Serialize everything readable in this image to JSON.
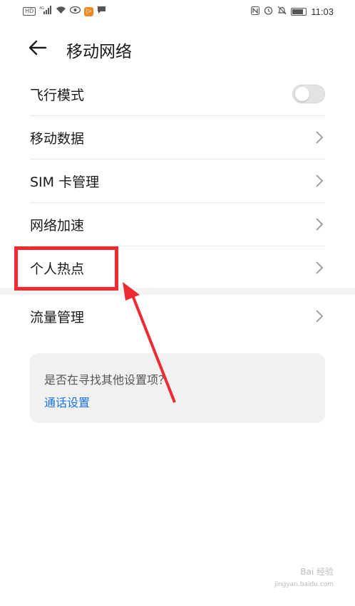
{
  "status_bar": {
    "left_icons": [
      "hd-icon",
      "signal-4g-icon",
      "wifi-icon",
      "eye-icon",
      "app-badge-icon",
      "message-icon"
    ],
    "right_icons": [
      "nfc-icon",
      "alarm-icon",
      "mute-icon",
      "battery-icon"
    ],
    "time": "11:03"
  },
  "header": {
    "title": "移动网络"
  },
  "settings": {
    "items": [
      {
        "label": "飞行模式",
        "control": "toggle",
        "toggle_on": false
      },
      {
        "label": "移动数据",
        "control": "chevron"
      },
      {
        "label": "SIM 卡管理",
        "control": "chevron"
      },
      {
        "label": "网络加速",
        "control": "chevron"
      },
      {
        "label": "个人热点",
        "control": "chevron"
      }
    ],
    "extra_item": {
      "label": "流量管理",
      "control": "chevron"
    }
  },
  "suggestion": {
    "question": "是否在寻找其他设置项？",
    "link": "通话设置"
  },
  "annotation": {
    "highlight_color": "#ee2b33"
  },
  "watermark": {
    "text": "Bai 经验",
    "sub": "jingyan.baidu.com"
  }
}
